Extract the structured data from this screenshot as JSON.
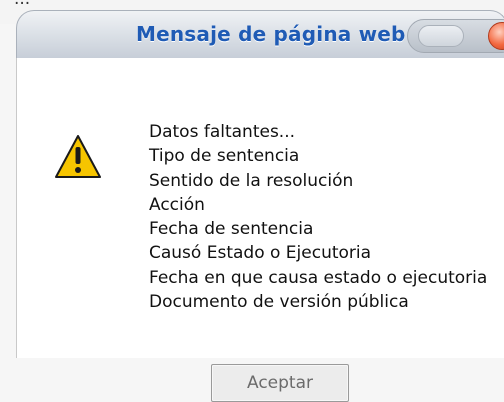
{
  "background_text": "...",
  "dialog": {
    "title": "Mensaje de página web",
    "icon": "warning-icon",
    "messages": [
      "Datos faltantes...",
      "Tipo de sentencia",
      "Sentido de la resolución",
      "Acción",
      "Fecha de sentencia",
      "Causó Estado o Ejecutoria",
      "Fecha en que causa estado o ejecutoria",
      "Documento de versión pública"
    ],
    "accept_label": "Aceptar"
  },
  "colors": {
    "title_text": "#1f5bb5",
    "warning_fill": "#f6c500",
    "close_button": "#f3683f"
  }
}
